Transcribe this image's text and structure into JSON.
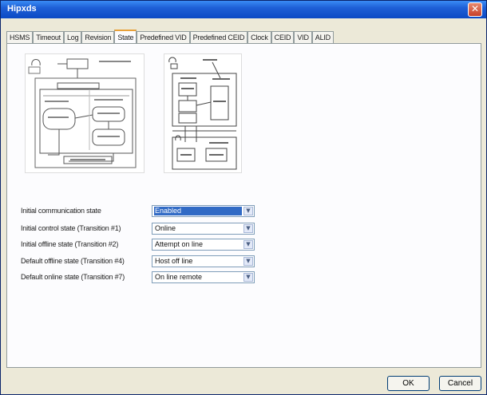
{
  "window": {
    "title": "Hipxds"
  },
  "tabs": [
    {
      "label": "HSMS"
    },
    {
      "label": "Timeout"
    },
    {
      "label": "Log"
    },
    {
      "label": "Revision"
    },
    {
      "label": "State"
    },
    {
      "label": "Predefined VID"
    },
    {
      "label": "Predefined CEID"
    },
    {
      "label": "Clock"
    },
    {
      "label": "CEID"
    },
    {
      "label": "VID"
    },
    {
      "label": "ALID"
    }
  ],
  "active_tab_index": 4,
  "fields": [
    {
      "label": "Initial communication state",
      "value": "Enabled",
      "selected": true
    },
    {
      "label": "Initial control state (Transition #1)",
      "value": "Online",
      "selected": false
    },
    {
      "label": "Initial offline state (Transition #2)",
      "value": "Attempt on line",
      "selected": false
    },
    {
      "label": "Default offline state (Transition #4)",
      "value": "Host off line",
      "selected": false
    },
    {
      "label": "Default online state (Transition #7)",
      "value": "On line remote",
      "selected": false
    }
  ],
  "buttons": {
    "ok": "OK",
    "cancel": "Cancel"
  },
  "icons": {
    "close": "close-icon",
    "dropdown": "chevron-down-icon"
  },
  "colors": {
    "titlebar": "#0b49c4",
    "selection": "#316ac5",
    "active_tab_accent": "#e8a13a"
  }
}
